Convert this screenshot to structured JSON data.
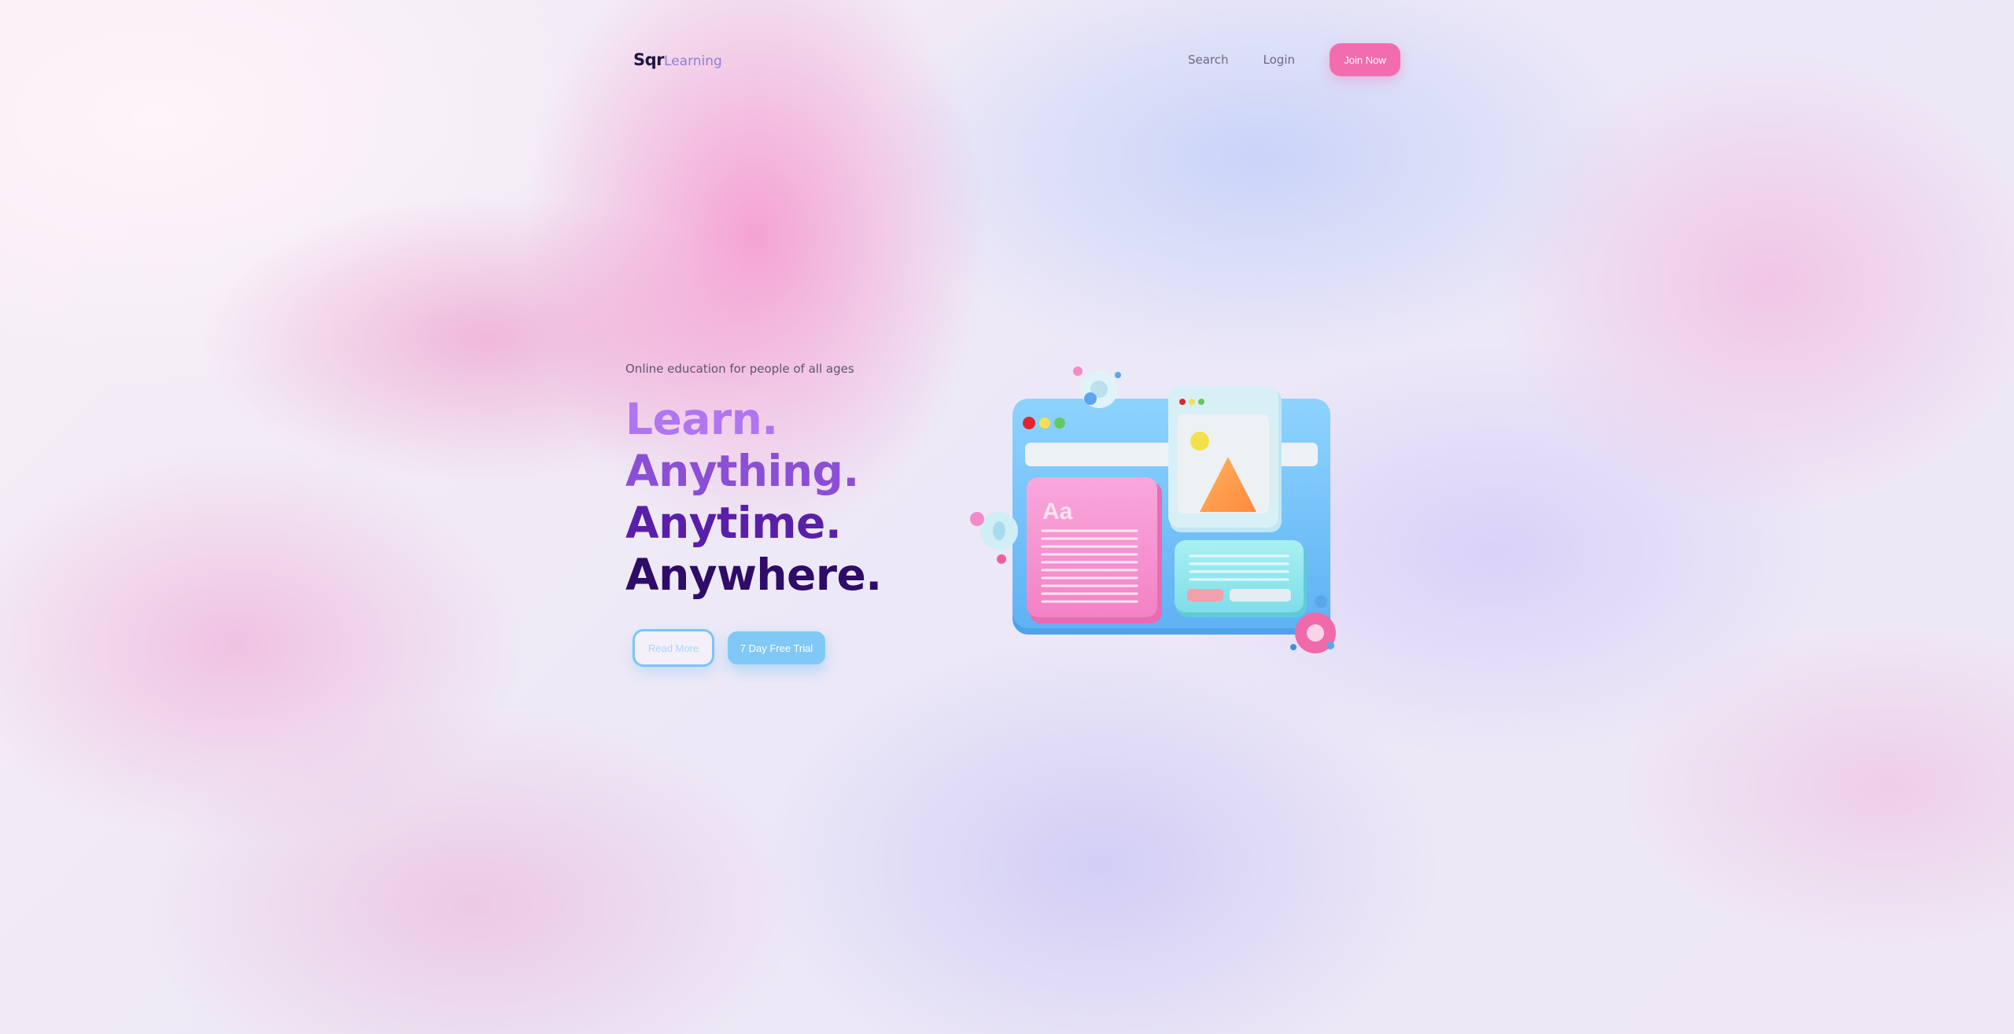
{
  "brand": {
    "name_strong": "Sqr",
    "name_light": "Learning"
  },
  "nav": {
    "search": "Search",
    "login": "Login",
    "join": "Join Now"
  },
  "hero": {
    "tagline": "Online education for people of all ages",
    "lines": [
      "Learn.",
      "Anything.",
      "Anytime.",
      "Anywhere."
    ],
    "read_more": "Read More",
    "trial": "7 Day Free Trial"
  },
  "illustration": {
    "card_label": "Aa"
  },
  "colors": {
    "accent_pink": "#f26db0",
    "accent_blue": "#80c9f6",
    "headline_1": "#b075f0",
    "headline_2": "#8b4fd6",
    "headline_3": "#5a1fa8",
    "headline_4": "#2e0c68"
  }
}
